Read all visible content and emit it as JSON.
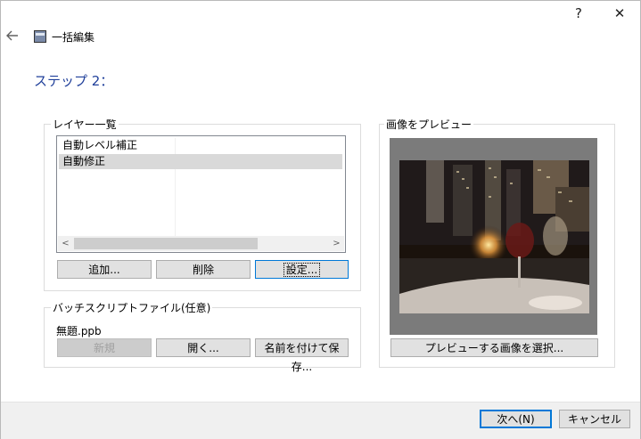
{
  "titlebar": {
    "help_label": "?",
    "close_label": "✕"
  },
  "header": {
    "title": "一括編集"
  },
  "step": {
    "label": "ステップ 2："
  },
  "layers": {
    "group_label": "レイヤー一覧",
    "items": [
      "自動レベル補正",
      "自動修正"
    ],
    "selected_index": 1,
    "add_label": "追加...",
    "delete_label": "削除",
    "settings_label": "設定..."
  },
  "batch": {
    "group_label": "バッチスクリプトファイル(任意)",
    "filename": "無題.ppb",
    "new_label": "新規",
    "open_label": "開く...",
    "save_as_label": "名前を付けて保存..."
  },
  "preview": {
    "group_label": "画像をプレビュー",
    "select_label": "プレビューする画像を選択..."
  },
  "footer": {
    "next_label": "次へ(N)",
    "cancel_label": "キャンセル"
  }
}
